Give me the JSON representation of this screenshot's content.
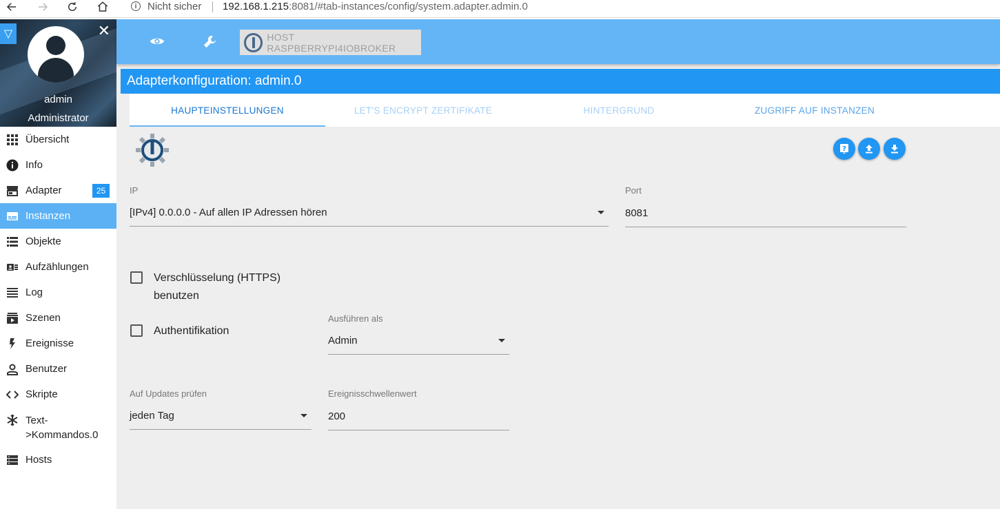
{
  "browser": {
    "security_label": "Nicht sicher",
    "url_host": "192.168.1.215",
    "url_rest": ":8081/#tab-instances/config/system.adapter.admin.0"
  },
  "sidebar": {
    "user_name": "admin",
    "user_role": "Administrator",
    "items": [
      {
        "label": "Übersicht",
        "icon": "grid-icon"
      },
      {
        "label": "Info",
        "icon": "info-icon"
      },
      {
        "label": "Adapter",
        "icon": "store-icon",
        "badge": "25"
      },
      {
        "label": "Instanzen",
        "icon": "instances-icon",
        "active": true
      },
      {
        "label": "Objekte",
        "icon": "list-icon"
      },
      {
        "label": "Aufzählungen",
        "icon": "enum-icon"
      },
      {
        "label": "Log",
        "icon": "log-icon"
      },
      {
        "label": "Szenen",
        "icon": "scenes-icon"
      },
      {
        "label": "Ereignisse",
        "icon": "flash-icon"
      },
      {
        "label": "Benutzer",
        "icon": "user-icon"
      },
      {
        "label": "Skripte",
        "icon": "code-icon"
      },
      {
        "label": "Text-\n>Kommandos.0",
        "icon": "snowflake-icon"
      },
      {
        "label": "Hosts",
        "icon": "hosts-icon"
      }
    ]
  },
  "toolbar": {
    "host_button_label": "HOST RASPBERRYPI4IOBROKER"
  },
  "panel": {
    "title": "Adapterkonfiguration: admin.0",
    "tabs": [
      "HAUPTEINSTELLUNGEN",
      "LET'S ENCRYPT ZERTIFIKATE",
      "HINTERGRUND",
      "ZUGRIFF AUF INSTANZEN"
    ]
  },
  "form": {
    "ip_label": "IP",
    "ip_value": "[IPv4] 0.0.0.0 - Auf allen IP Adressen hören",
    "port_label": "Port",
    "port_value": "8081",
    "https_label_line1": "Verschlüsselung (HTTPS)",
    "https_label_line2": "benutzen",
    "https_checked": false,
    "auth_label": "Authentifikation",
    "auth_checked": false,
    "run_as_label": "Ausführen als",
    "run_as_value": "Admin",
    "updates_label": "Auf Updates prüfen",
    "updates_value": "jeden Tag",
    "threshold_label": "Ereignisschwellenwert",
    "threshold_value": "200"
  }
}
